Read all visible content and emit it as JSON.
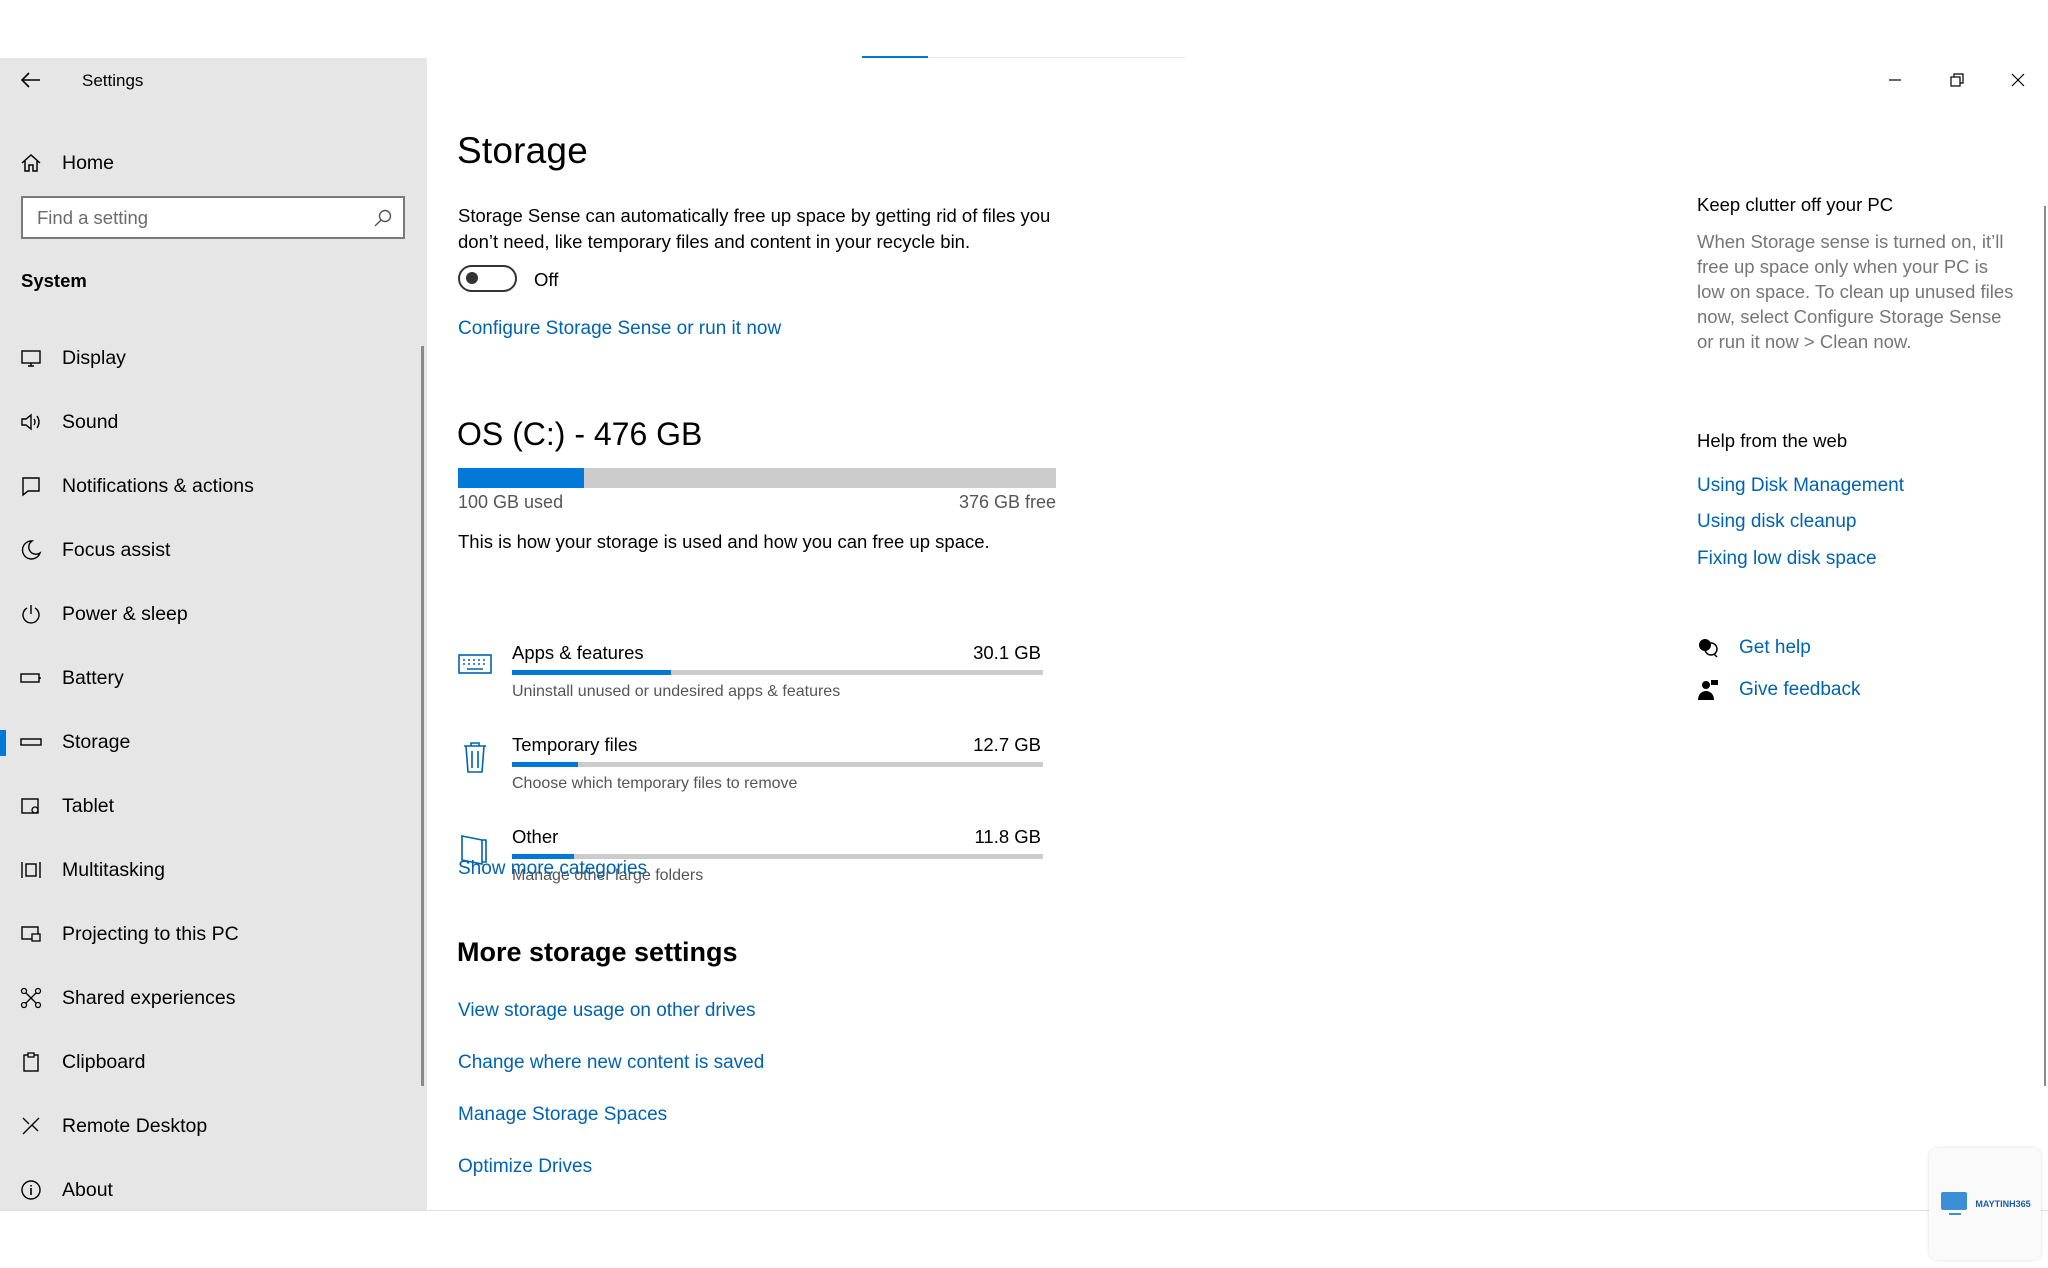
{
  "app": {
    "title": "Settings"
  },
  "sidebar": {
    "home_label": "Home",
    "search_placeholder": "Find a setting",
    "section": "System",
    "items": [
      {
        "label": "Display",
        "icon": "monitor-icon"
      },
      {
        "label": "Sound",
        "icon": "speaker-icon"
      },
      {
        "label": "Notifications & actions",
        "icon": "notification-icon"
      },
      {
        "label": "Focus assist",
        "icon": "moon-icon"
      },
      {
        "label": "Power & sleep",
        "icon": "power-icon"
      },
      {
        "label": "Battery",
        "icon": "battery-icon"
      },
      {
        "label": "Storage",
        "icon": "storage-icon",
        "selected": true
      },
      {
        "label": "Tablet",
        "icon": "tablet-icon"
      },
      {
        "label": "Multitasking",
        "icon": "multitasking-icon"
      },
      {
        "label": "Projecting to this PC",
        "icon": "projecting-icon"
      },
      {
        "label": "Shared experiences",
        "icon": "shared-icon"
      },
      {
        "label": "Clipboard",
        "icon": "clipboard-icon"
      },
      {
        "label": "Remote Desktop",
        "icon": "remote-desktop-icon"
      },
      {
        "label": "About",
        "icon": "info-icon"
      }
    ]
  },
  "main": {
    "title": "Storage",
    "storage_sense_desc": "Storage Sense can automatically free up space by getting rid of files you don’t need, like temporary files and content in your recycle bin.",
    "toggle_state": "Off",
    "configure_link": "Configure Storage Sense or run it now",
    "drive": {
      "title": "OS (C:) - 476 GB",
      "used_label": "100 GB used",
      "free_label": "376 GB free",
      "used_fraction": 0.21
    },
    "explain": "This is how your storage is used and how you can free up space.",
    "categories": [
      {
        "name": "Apps & features",
        "size": "30.1 GB",
        "desc": "Uninstall unused or undesired apps & features",
        "fraction": 0.3,
        "icon": "keyboard-icon"
      },
      {
        "name": "Temporary files",
        "size": "12.7 GB",
        "desc": "Choose which temporary files to remove",
        "fraction": 0.125,
        "icon": "trash-icon"
      },
      {
        "name": "Other",
        "size": "11.8 GB",
        "desc": "Manage other large folders",
        "fraction": 0.117,
        "icon": "folder-icon"
      }
    ],
    "show_more": "Show more categories",
    "more_title": "More storage settings",
    "more_links": [
      "View storage usage on other drives",
      "Change where new content is saved",
      "Manage Storage Spaces",
      "Optimize Drives"
    ]
  },
  "right": {
    "tip_title": "Keep clutter off your PC",
    "tip_text": "When Storage sense is turned on, it’ll free up space only when your PC is low on space. To clean up unused files now, select Configure Storage Sense or run it now > Clean now.",
    "help_title": "Help from the web",
    "help_links": [
      "Using Disk Management",
      "Using disk cleanup",
      "Fixing low disk space"
    ],
    "get_help": "Get help",
    "give_feedback": "Give feedback"
  },
  "watermark": {
    "text": "MAYTINH365"
  },
  "colors": {
    "accent": "#0078d7",
    "link": "#0063b1",
    "sidebar_bg": "#e6e6e6"
  }
}
